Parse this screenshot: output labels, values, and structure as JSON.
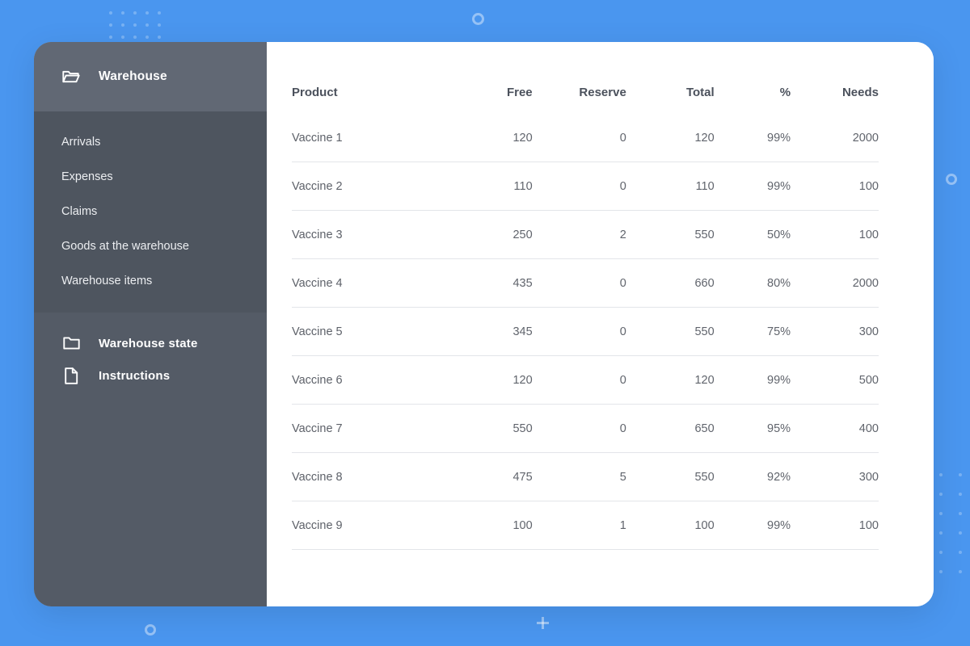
{
  "app": {
    "background_color": "#4a96ef",
    "card_color": "#ffffff"
  },
  "sidebar": {
    "header": {
      "icon": "open-folder-icon",
      "title": "Warehouse"
    },
    "links": [
      {
        "label": "Arrivals"
      },
      {
        "label": "Expenses"
      },
      {
        "label": "Claims"
      },
      {
        "label": "Goods at the warehouse"
      },
      {
        "label": "Warehouse items"
      }
    ],
    "items": [
      {
        "icon": "folder-icon",
        "label": "Warehouse state"
      },
      {
        "icon": "document-icon",
        "label": "Instructions"
      }
    ]
  },
  "table": {
    "columns": [
      {
        "key": "product",
        "label": "Product"
      },
      {
        "key": "free",
        "label": "Free"
      },
      {
        "key": "reserve",
        "label": "Reserve"
      },
      {
        "key": "total",
        "label": "Total"
      },
      {
        "key": "pct",
        "label": "%"
      },
      {
        "key": "needs",
        "label": "Needs"
      }
    ],
    "rows": [
      {
        "product": "Vaccine 1",
        "free": "120",
        "reserve": "0",
        "total": "120",
        "pct": "99%",
        "needs": "2000"
      },
      {
        "product": "Vaccine 2",
        "free": "110",
        "reserve": "0",
        "total": "110",
        "pct": "99%",
        "needs": "100"
      },
      {
        "product": "Vaccine 3",
        "free": "250",
        "reserve": "2",
        "total": "550",
        "pct": "50%",
        "needs": "100"
      },
      {
        "product": "Vaccine 4",
        "free": "435",
        "reserve": "0",
        "total": "660",
        "pct": "80%",
        "needs": "2000"
      },
      {
        "product": "Vaccine 5",
        "free": "345",
        "reserve": "0",
        "total": "550",
        "pct": "75%",
        "needs": "300"
      },
      {
        "product": "Vaccine 6",
        "free": "120",
        "reserve": "0",
        "total": "120",
        "pct": "99%",
        "needs": "500"
      },
      {
        "product": "Vaccine 7",
        "free": "550",
        "reserve": "0",
        "total": "650",
        "pct": "95%",
        "needs": "400"
      },
      {
        "product": "Vaccine 8",
        "free": "475",
        "reserve": "5",
        "total": "550",
        "pct": "92%",
        "needs": "300"
      },
      {
        "product": "Vaccine 9",
        "free": "100",
        "reserve": "1",
        "total": "100",
        "pct": "99%",
        "needs": "100"
      }
    ]
  },
  "decorations": [
    {
      "name": "dot-grid-top-left"
    },
    {
      "name": "ring-top"
    },
    {
      "name": "ring-right"
    },
    {
      "name": "dot-grid-bottom-right"
    },
    {
      "name": "ring-bottom-left"
    },
    {
      "name": "plus-bottom"
    }
  ]
}
